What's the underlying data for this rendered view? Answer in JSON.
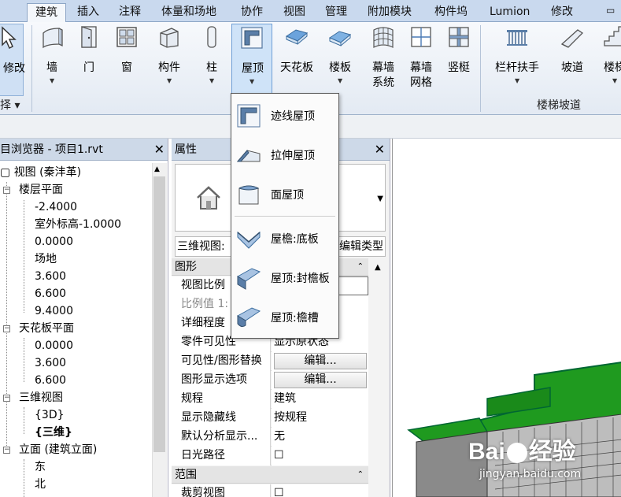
{
  "ribbon": {
    "tabs": [
      "建筑",
      "插入",
      "注释",
      "体量和场地",
      "协作",
      "视图",
      "管理",
      "附加模块",
      "构件坞",
      "Lumion",
      "修改"
    ],
    "buttons": {
      "modify": "修改",
      "wall": "墙",
      "door": "门",
      "window": "窗",
      "component": "构件",
      "column": "柱",
      "roof": "屋顶",
      "ceiling": "天花板",
      "floor": "楼板",
      "curtain_system": "幕墙\n系统",
      "curtain_grid": "幕墙\n网格",
      "mullion": "竖梃",
      "railing": "栏杆扶手",
      "ramp": "坡道",
      "stair": "楼梯"
    },
    "groups": {
      "select": "择 ▾",
      "circulation": "楼梯坡道"
    }
  },
  "roof_menu": {
    "items": [
      "迹线屋顶",
      "拉伸屋顶",
      "面屋顶",
      "屋檐:底板",
      "屋顶:封檐板",
      "屋顶:檐槽"
    ]
  },
  "project_browser": {
    "title": "目浏览器 - 项目1.rvt",
    "root": "视图 (秦沣革)",
    "floor_plans": {
      "label": "楼层平面",
      "items": [
        "-2.4000",
        "室外标高-1.0000",
        "0.0000",
        "场地",
        "3.600",
        "6.600",
        "9.4000"
      ]
    },
    "ceiling_plans": {
      "label": "天花板平面",
      "items": [
        "0.0000",
        "3.600",
        "6.600"
      ]
    },
    "views_3d": {
      "label": "三维视图",
      "items": [
        "{3D}",
        "{三维}"
      ]
    },
    "elevations": {
      "label": "立面 (建筑立面)",
      "items": [
        "东",
        "北"
      ]
    }
  },
  "properties": {
    "title": "属性",
    "view_type": "三维视图:",
    "edit_type": "编辑类型",
    "sections": {
      "graphics": "图形",
      "extents": "范围"
    },
    "rows": [
      {
        "k": "视图比例",
        "v": ""
      },
      {
        "k": "比例值 1:",
        "v": ""
      },
      {
        "k": "详细程度",
        "v": ""
      },
      {
        "k": "零件可见性",
        "v": "显示原状态"
      },
      {
        "k": "可见性/图形替换",
        "v": "编辑..."
      },
      {
        "k": "图形显示选项",
        "v": "编辑..."
      },
      {
        "k": "规程",
        "v": "建筑"
      },
      {
        "k": "显示隐藏线",
        "v": "按规程"
      },
      {
        "k": "默认分析显示...",
        "v": "无"
      },
      {
        "k": "日光路径",
        "v": "☐"
      },
      {
        "k": "裁剪视图",
        "v": "☐"
      }
    ]
  },
  "watermark": {
    "brand": "Bai",
    "brand2": "经验",
    "url": "jingyan.baidu.com"
  },
  "colors": {
    "accent": "#2b6fc2",
    "ribbon": "#c9d9ee",
    "roof_green": "#1f9a1f"
  }
}
